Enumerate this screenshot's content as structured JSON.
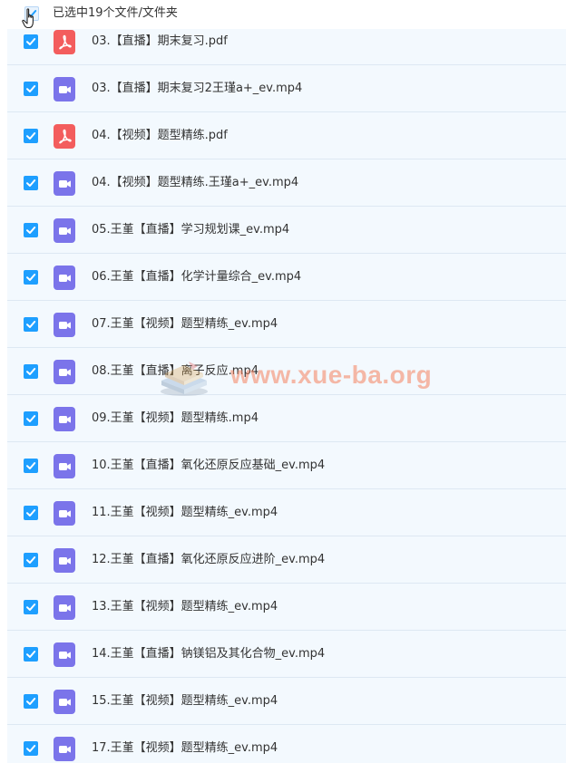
{
  "header": {
    "selection_text": "已选中19个文件/文件夹"
  },
  "files": [
    {
      "name": "03.【直播】期末复习.pdf",
      "type": "pdf",
      "checked": true
    },
    {
      "name": "03.【直播】期末复习2王瑾a+_ev.mp4",
      "type": "video",
      "checked": true
    },
    {
      "name": "04.【视频】题型精练.pdf",
      "type": "pdf",
      "checked": true
    },
    {
      "name": "04.【视频】题型精练.王瑾a+_ev.mp4",
      "type": "video",
      "checked": true
    },
    {
      "name": "05.王堇【直播】学习规划课_ev.mp4",
      "type": "video",
      "checked": true
    },
    {
      "name": "06.王堇【直播】化学计量综合_ev.mp4",
      "type": "video",
      "checked": true
    },
    {
      "name": "07.王堇【视频】题型精练_ev.mp4",
      "type": "video",
      "checked": true
    },
    {
      "name": "08.王堇【直播】离子反应.mp4",
      "type": "video",
      "checked": true
    },
    {
      "name": "09.王堇【视频】题型精练.mp4",
      "type": "video",
      "checked": true
    },
    {
      "name": "10.王堇【直播】氧化还原反应基础_ev.mp4",
      "type": "video",
      "checked": true
    },
    {
      "name": "11.王堇【视频】题型精练_ev.mp4",
      "type": "video",
      "checked": true
    },
    {
      "name": "12.王堇【直播】氧化还原反应进阶_ev.mp4",
      "type": "video",
      "checked": true
    },
    {
      "name": "13.王堇【视频】题型精练_ev.mp4",
      "type": "video",
      "checked": true
    },
    {
      "name": "14.王堇【直播】钠镁铝及其化合物_ev.mp4",
      "type": "video",
      "checked": true
    },
    {
      "name": "15.王堇【视频】题型精练_ev.mp4",
      "type": "video",
      "checked": true
    },
    {
      "name": "17.王堇【视频】题型精练_ev.mp4",
      "type": "video",
      "checked": true
    }
  ],
  "watermark": {
    "text": "www.xue-ba.org"
  },
  "colors": {
    "checkbox": "#1e9fff",
    "pdf_icon": "#f35d5d",
    "video_icon": "#7b74ea",
    "row_bg": "#f3f9fe",
    "watermark": "#f4825c"
  }
}
